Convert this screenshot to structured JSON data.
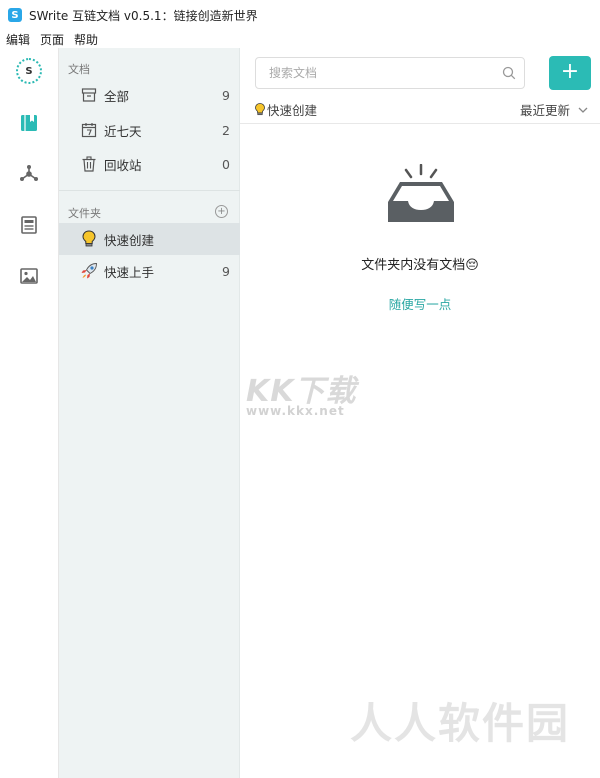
{
  "window": {
    "logo_letter": "S",
    "title": "SWrite 互链文档 v0.5.1：链接创造新世界"
  },
  "menu": [
    "编辑",
    "页面",
    "帮助"
  ],
  "iconbar": {
    "avatar_letter": "S",
    "items": [
      "book-icon",
      "share-graph-icon",
      "document-icon",
      "image-icon"
    ]
  },
  "sidebar": {
    "docs_section": "文档",
    "docs_items": [
      {
        "label": "全部",
        "count": "9",
        "icon": "archive-icon"
      },
      {
        "label": "近七天",
        "count": "2",
        "icon": "calendar-icon"
      },
      {
        "label": "回收站",
        "count": "0",
        "icon": "trash-icon"
      }
    ],
    "folders_section": "文件夹",
    "folders": [
      {
        "label": "快速创建",
        "count": "",
        "icon": "lightbulb-icon",
        "active": true
      },
      {
        "label": "快速上手",
        "count": "9",
        "icon": "rocket-icon"
      }
    ]
  },
  "main": {
    "search_placeholder": "搜索文档",
    "add_label": "+",
    "quick_tag": "快速创建",
    "sort_label": "最近更新",
    "empty_text": "文件夹内没有文档😔",
    "write_link": "随便写一点"
  },
  "watermarks": {
    "kk_title": "KK下载",
    "kk_url": "www.kkx.net",
    "rr_title": "人人软件园"
  },
  "colors": {
    "accent": "#2bbbb5",
    "link": "#2aa7a3",
    "sidebar_bg": "#eef3f3",
    "active_bg": "#dde3e5"
  }
}
